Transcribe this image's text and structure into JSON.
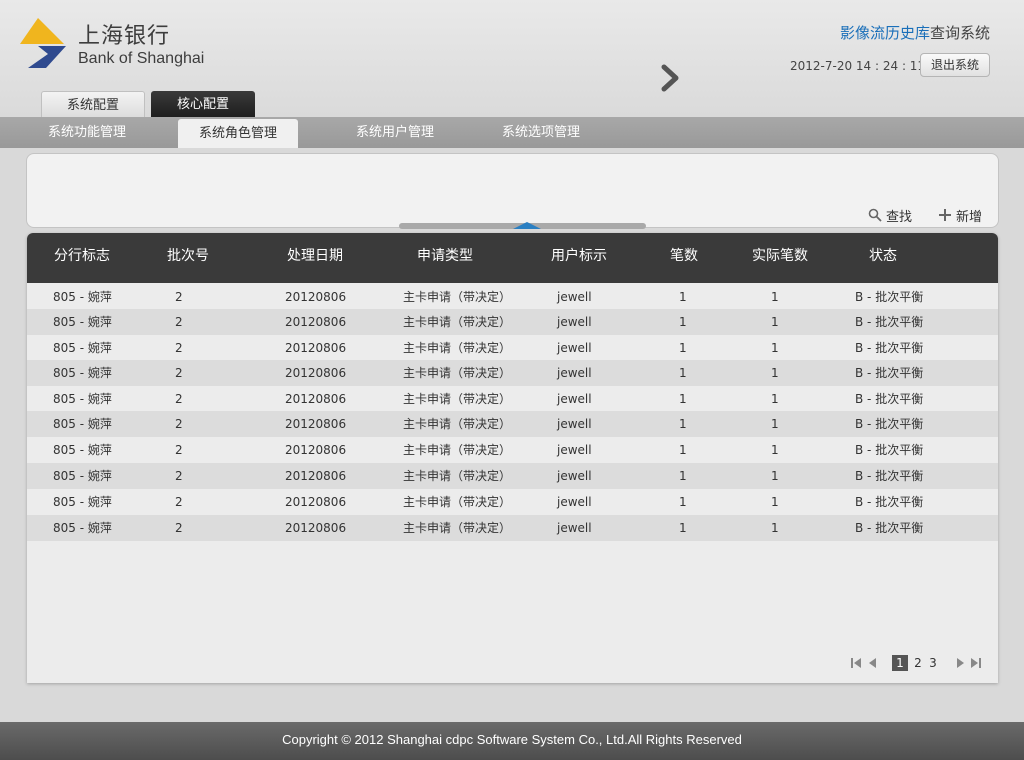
{
  "brand": {
    "name_cn": "上海银行",
    "name_en": "Bank of Shanghai"
  },
  "system_title": {
    "blue": "影像流历史库",
    "grey": "查询系统"
  },
  "datetime": "2012-7-20 14 : 24 : 11",
  "logout_label": "退出系统",
  "top_tabs": [
    {
      "label": "系统配置"
    },
    {
      "label": "核心配置"
    }
  ],
  "subnav": [
    {
      "label": "系统功能管理"
    },
    {
      "label": "系统角色管理"
    },
    {
      "label": "系统用户管理"
    },
    {
      "label": "系统选项管理"
    }
  ],
  "tools": {
    "search_label": "查找",
    "add_label": "新增"
  },
  "table": {
    "headers": [
      "分行标志",
      "批次号",
      "处理日期",
      "申请类型",
      "用户标示",
      "笔数",
      "实际笔数",
      "状态"
    ],
    "rows": [
      [
        "805 - 婉萍",
        "2",
        "20120806",
        "主卡申请（带决定）",
        "jewell",
        "1",
        "1",
        "B - 批次平衡"
      ],
      [
        "805 - 婉萍",
        "2",
        "20120806",
        "主卡申请（带决定）",
        "jewell",
        "1",
        "1",
        "B - 批次平衡"
      ],
      [
        "805 - 婉萍",
        "2",
        "20120806",
        "主卡申请（带决定）",
        "jewell",
        "1",
        "1",
        "B - 批次平衡"
      ],
      [
        "805 - 婉萍",
        "2",
        "20120806",
        "主卡申请（带决定）",
        "jewell",
        "1",
        "1",
        "B - 批次平衡"
      ],
      [
        "805 - 婉萍",
        "2",
        "20120806",
        "主卡申请（带决定）",
        "jewell",
        "1",
        "1",
        "B - 批次平衡"
      ],
      [
        "805 - 婉萍",
        "2",
        "20120806",
        "主卡申请（带决定）",
        "jewell",
        "1",
        "1",
        "B - 批次平衡"
      ],
      [
        "805 - 婉萍",
        "2",
        "20120806",
        "主卡申请（带决定）",
        "jewell",
        "1",
        "1",
        "B - 批次平衡"
      ],
      [
        "805 - 婉萍",
        "2",
        "20120806",
        "主卡申请（带决定）",
        "jewell",
        "1",
        "1",
        "B - 批次平衡"
      ],
      [
        "805 - 婉萍",
        "2",
        "20120806",
        "主卡申请（带决定）",
        "jewell",
        "1",
        "1",
        "B - 批次平衡"
      ],
      [
        "805 - 婉萍",
        "2",
        "20120806",
        "主卡申请（带决定）",
        "jewell",
        "1",
        "1",
        "B - 批次平衡"
      ]
    ]
  },
  "pager": {
    "pages": [
      "1",
      "2",
      "3"
    ],
    "current": "1"
  },
  "footer": "Copyright  ©  2012 Shanghai cdpc Software System Co., Ltd.All Rights Reserved",
  "colors": {
    "accent_blue": "#1a6fb9",
    "header_dark": "#3a3a3a",
    "logo_yellow": "#f0b51e",
    "logo_navy": "#2f4a8f"
  }
}
